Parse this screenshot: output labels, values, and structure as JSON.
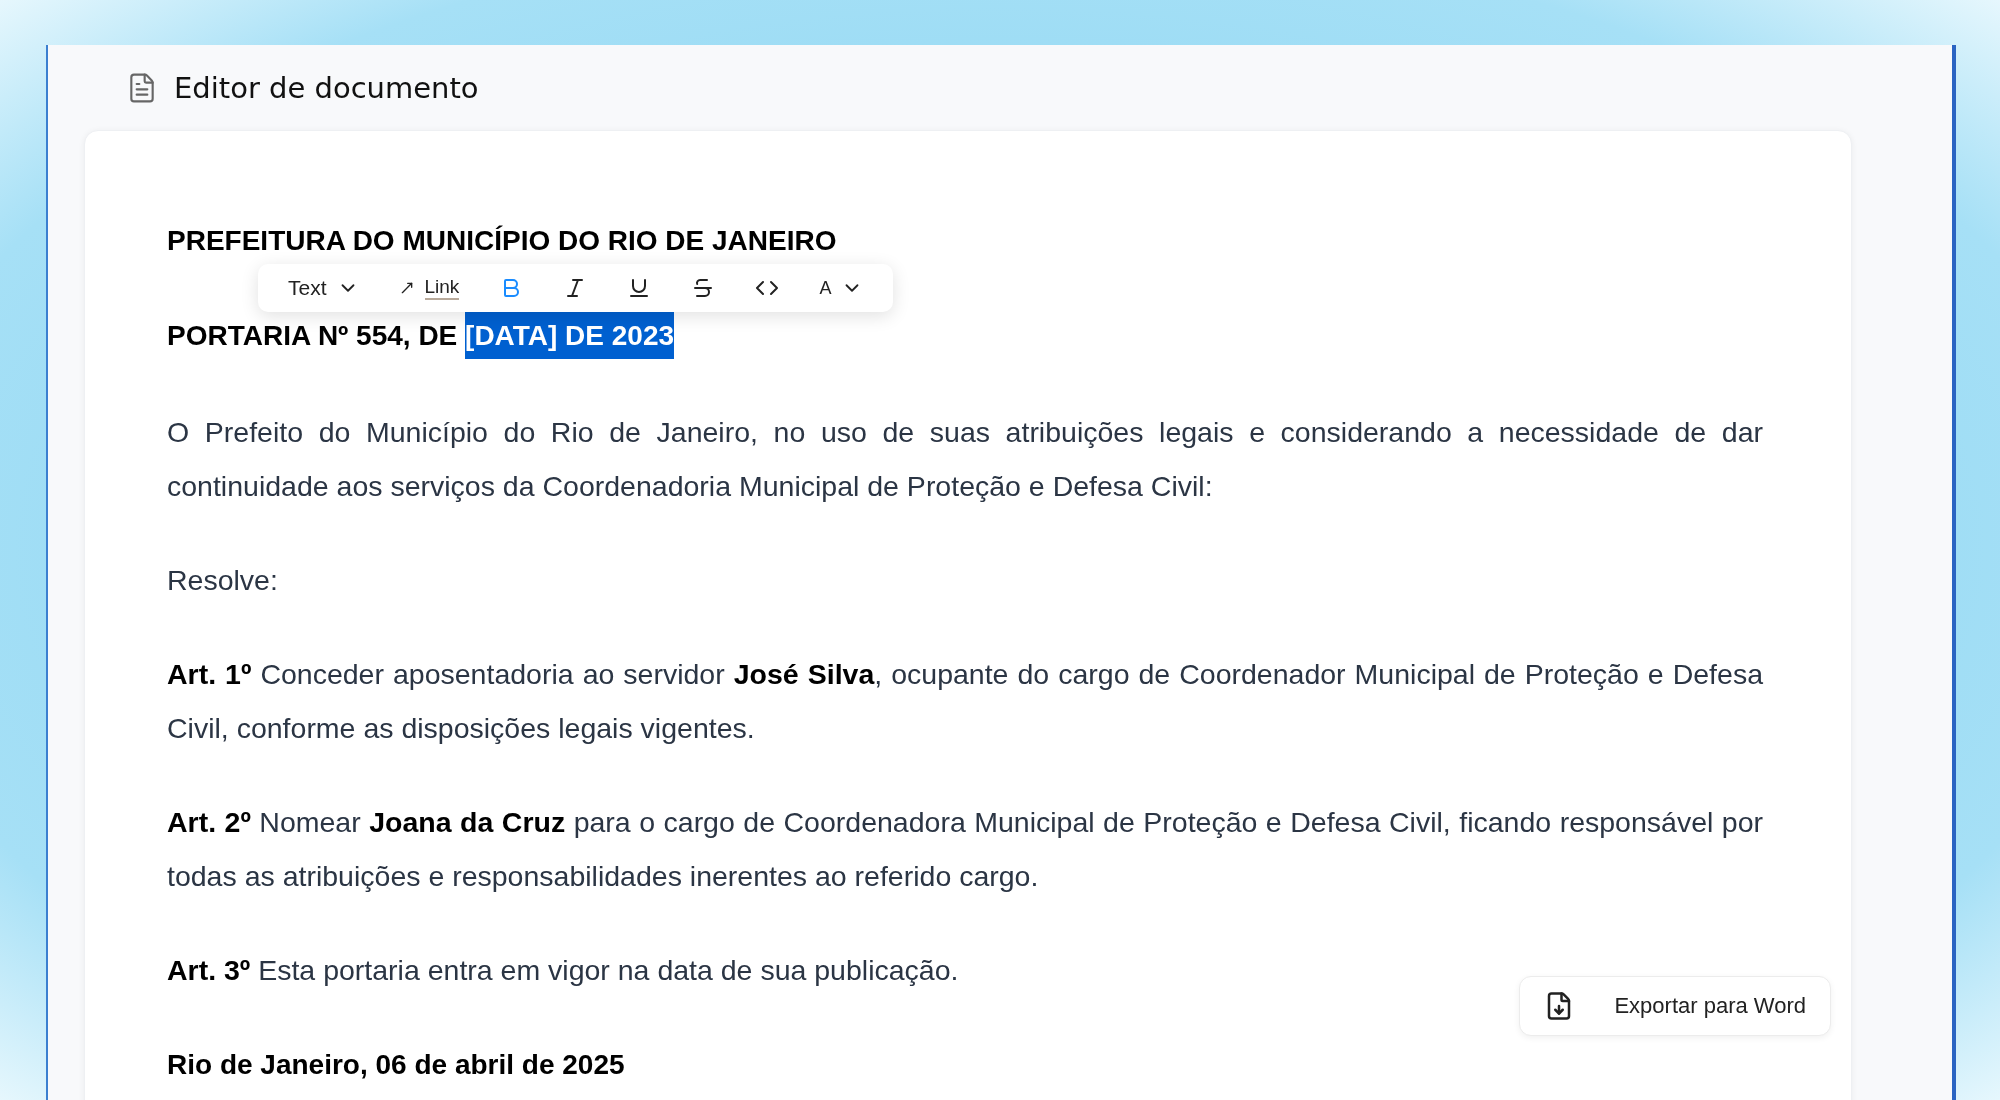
{
  "window": {
    "title": "Editor de documento"
  },
  "toolbar": [
    {
      "kind": "block",
      "label": "Text"
    },
    {
      "kind": "link",
      "label": "Link"
    },
    {
      "kind": "bold",
      "active": true
    },
    {
      "kind": "italic",
      "active": false
    },
    {
      "kind": "underline",
      "active": false
    },
    {
      "kind": "strike",
      "active": false
    },
    {
      "kind": "code",
      "active": false
    },
    {
      "kind": "color",
      "label": "A"
    }
  ],
  "document": [
    {
      "kind": "heading",
      "text": "PREFEITURA DO MUNICÍPIO DO RIO DE JANEIRO"
    },
    {
      "kind": "title",
      "segments": [
        {
          "text": "PORTARIA Nº 554, DE ",
          "selected": false
        },
        {
          "text": "[DATA] DE 2023",
          "selected": true
        }
      ]
    },
    {
      "kind": "paragraph",
      "text": "O Prefeito do Município do Rio de Janeiro, no uso de suas atribuições legais e considerando a necessidade de dar continuidade aos serviços da Coordenadoria Municipal de Proteção e Defesa Civil:"
    },
    {
      "kind": "paragraph",
      "text": "Resolve:"
    },
    {
      "kind": "paragraph",
      "text": "**Art. 1º** Conceder aposentadoria ao servidor **José Silva**, ocupante do cargo de Coordenador Municipal de Proteção e Defesa Civil, conforme as disposições legais vigentes."
    },
    {
      "kind": "paragraph",
      "text": "**Art. 2º** Nomear **Joana da Cruz** para o cargo de Coordenadora Municipal de Proteção e Defesa Civil, ficando responsável por todas as atribuições e responsabilidades inerentes ao referido cargo."
    },
    {
      "kind": "paragraph",
      "text": "**Art. 3º** Esta portaria entra em vigor na data de sua publicação."
    },
    {
      "kind": "heading",
      "text": "Rio de Janeiro, 06 de abril de 2025"
    }
  ],
  "export_button": {
    "label": "Exportar para Word"
  }
}
